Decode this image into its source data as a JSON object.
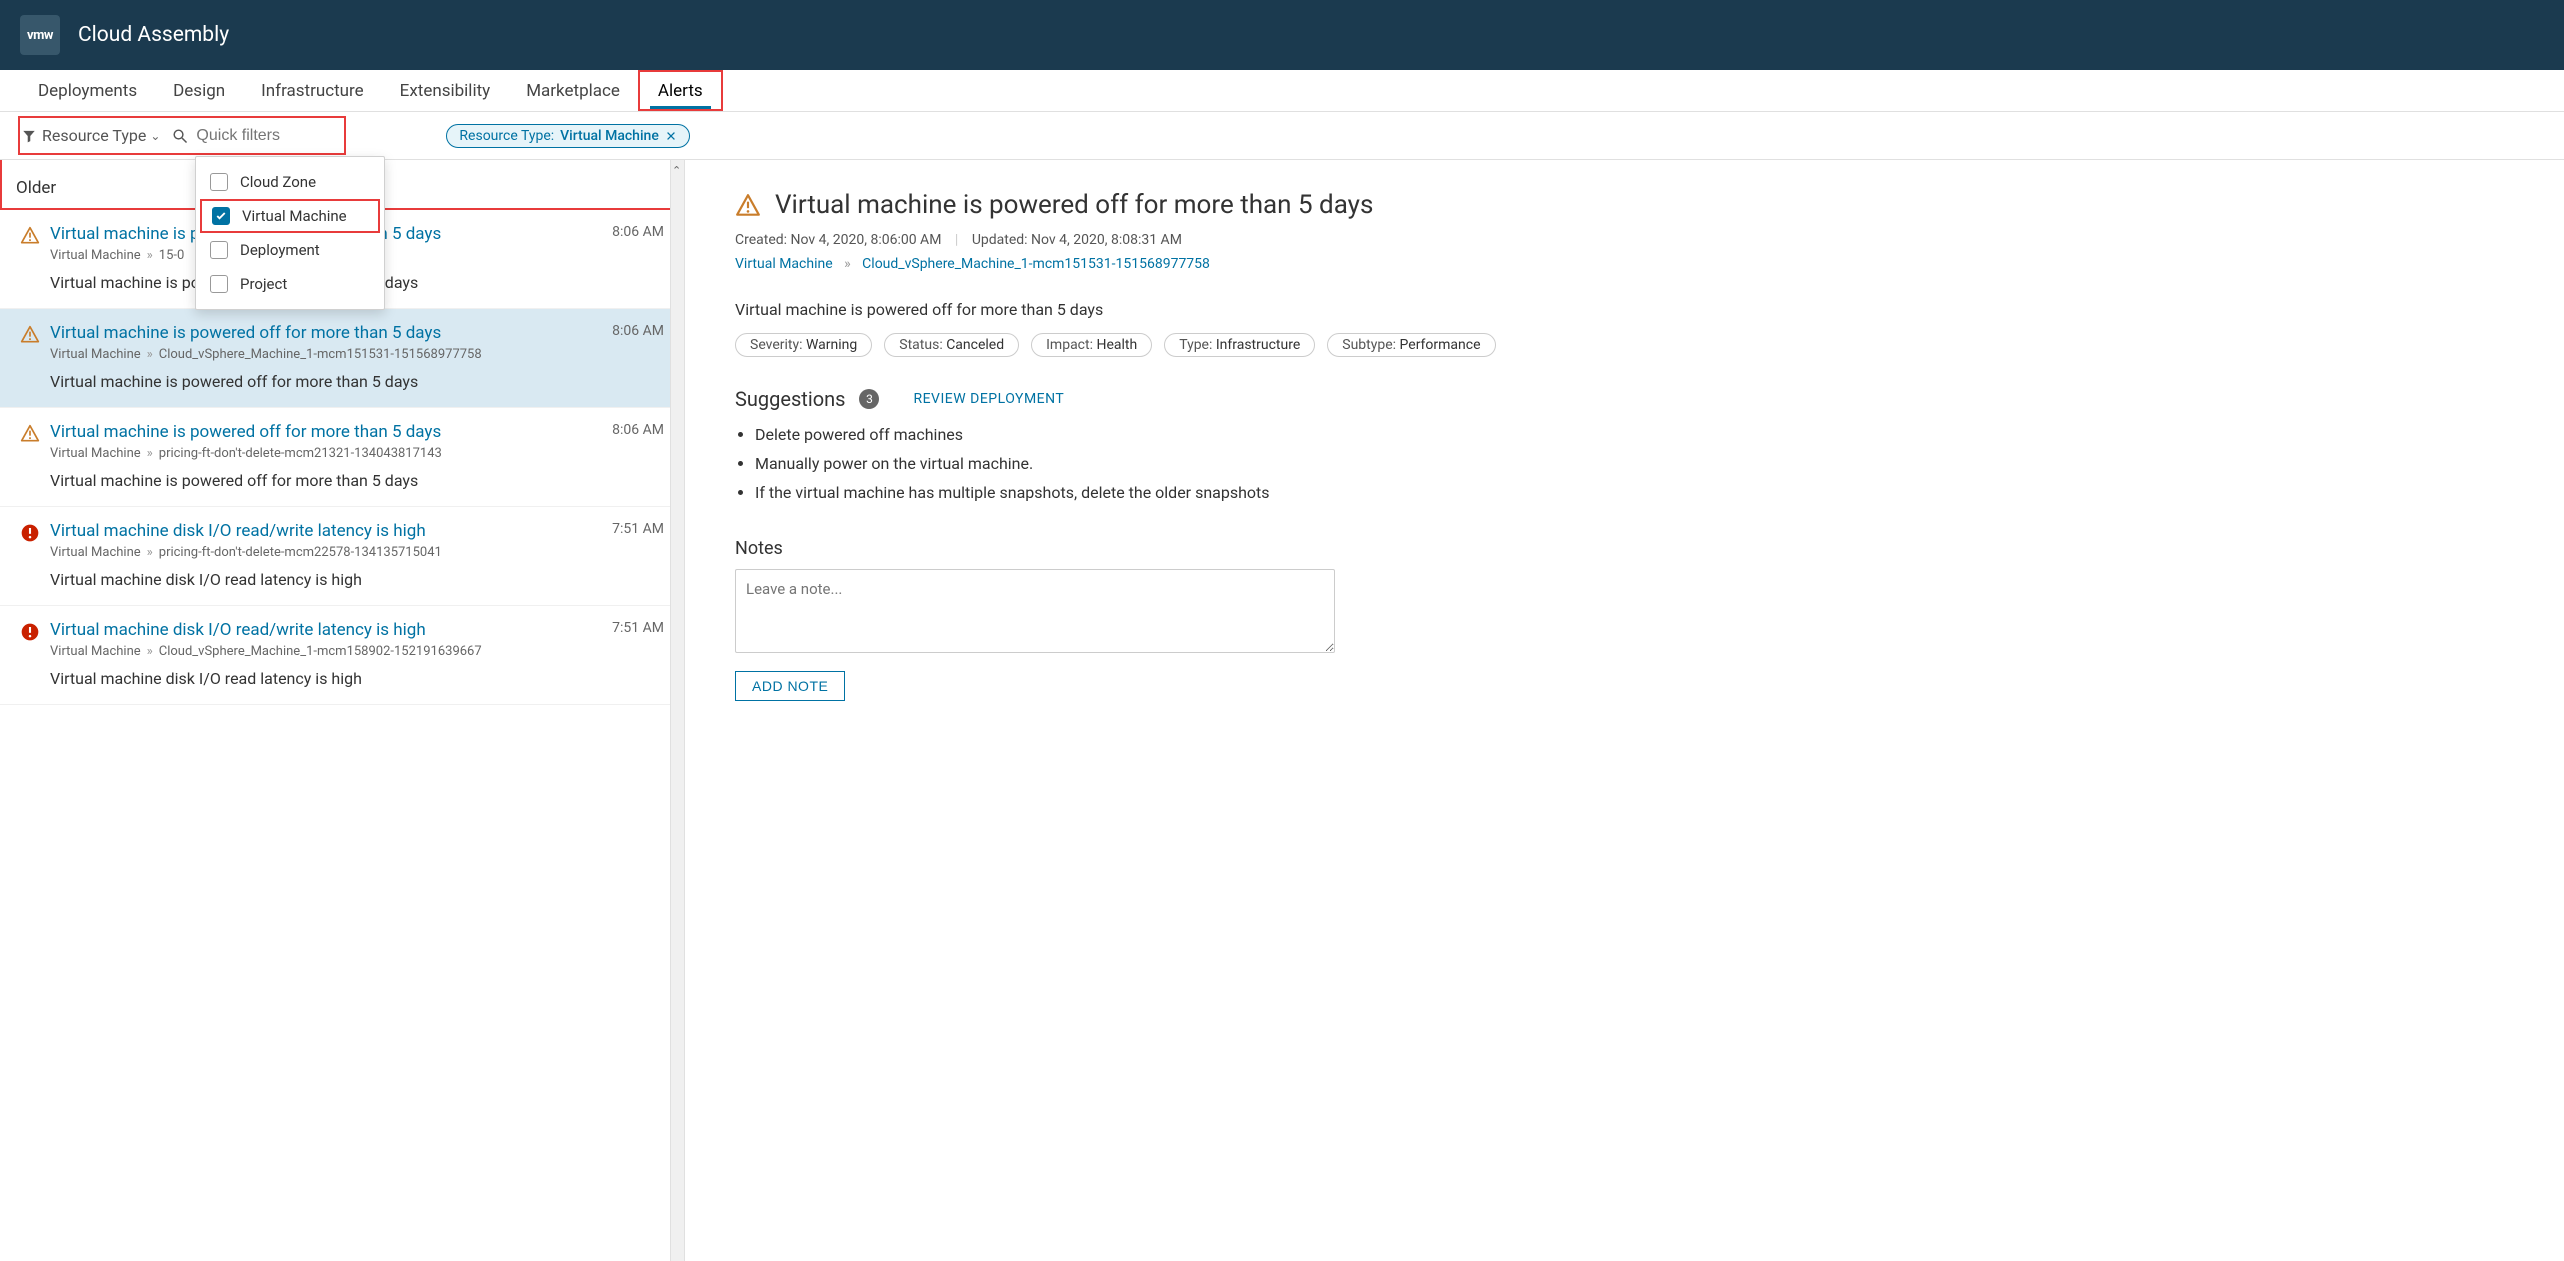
{
  "app": {
    "logo": "vmw",
    "title": "Cloud Assembly"
  },
  "tabs": [
    {
      "label": "Deployments",
      "active": false
    },
    {
      "label": "Design",
      "active": false
    },
    {
      "label": "Infrastructure",
      "active": false
    },
    {
      "label": "Extensibility",
      "active": false
    },
    {
      "label": "Marketplace",
      "active": false
    },
    {
      "label": "Alerts",
      "active": true,
      "highlighted": true
    }
  ],
  "filter": {
    "dropdown_label": "Resource Type",
    "search_placeholder": "Quick filters",
    "chip": {
      "label": "Resource Type:",
      "value": "Virtual Machine"
    },
    "options": [
      {
        "label": "Cloud Zone",
        "checked": false
      },
      {
        "label": "Virtual Machine",
        "checked": true,
        "highlighted": true
      },
      {
        "label": "Deployment",
        "checked": false
      },
      {
        "label": "Project",
        "checked": false
      }
    ]
  },
  "list": {
    "section_label": "Older",
    "items": [
      {
        "severity": "warning",
        "title": "Virtual machine is powered off for more than 5 days",
        "crumb_type": "Virtual Machine",
        "crumb_target": "15-0",
        "summary": "Virtual machine is powered off for more than 5 days",
        "time": "8:06 AM",
        "selected": false
      },
      {
        "severity": "warning",
        "title": "Virtual machine is powered off for more than 5 days",
        "crumb_type": "Virtual Machine",
        "crumb_target": "Cloud_vSphere_Machine_1-mcm151531-151568977758",
        "summary": "Virtual machine is powered off for more than 5 days",
        "time": "8:06 AM",
        "selected": true
      },
      {
        "severity": "warning",
        "title": "Virtual machine is powered off for more than 5 days",
        "crumb_type": "Virtual Machine",
        "crumb_target": "pricing-ft-don't-delete-mcm21321-134043817143",
        "summary": "Virtual machine is powered off for more than 5 days",
        "time": "8:06 AM",
        "selected": false
      },
      {
        "severity": "critical",
        "title": "Virtual machine disk I/O read/write latency is high",
        "crumb_type": "Virtual Machine",
        "crumb_target": "pricing-ft-don't-delete-mcm22578-134135715041",
        "summary": "Virtual machine disk I/O read latency is high",
        "time": "7:51 AM",
        "selected": false
      },
      {
        "severity": "critical",
        "title": "Virtual machine disk I/O read/write latency is high",
        "crumb_type": "Virtual Machine",
        "crumb_target": "Cloud_vSphere_Machine_1-mcm158902-152191639667",
        "summary": "Virtual machine disk I/O read latency is high",
        "time": "7:51 AM",
        "selected": false
      }
    ]
  },
  "detail": {
    "title": "Virtual machine is powered off for more than 5 days",
    "created_label": "Created:",
    "created": "Nov 4, 2020, 8:06:00 AM",
    "updated_label": "Updated:",
    "updated": "Nov 4, 2020, 8:08:31 AM",
    "crumb_type": "Virtual Machine",
    "crumb_target": "Cloud_vSphere_Machine_1-mcm151531-151568977758",
    "summary": "Virtual machine is powered off for more than 5 days",
    "tags": [
      {
        "label": "Severity:",
        "value": "Warning"
      },
      {
        "label": "Status:",
        "value": "Canceled"
      },
      {
        "label": "Impact:",
        "value": "Health"
      },
      {
        "label": "Type:",
        "value": "Infrastructure"
      },
      {
        "label": "Subtype:",
        "value": "Performance"
      }
    ],
    "suggestions_label": "Suggestions",
    "suggestions_count": "3",
    "review_link": "REVIEW DEPLOYMENT",
    "suggestions": [
      "Delete powered off machines",
      "Manually power on the virtual machine.",
      "If the virtual machine has multiple snapshots, delete the older snapshots"
    ],
    "notes_label": "Notes",
    "notes_placeholder": "Leave a note...",
    "add_note_btn": "ADD NOTE"
  }
}
